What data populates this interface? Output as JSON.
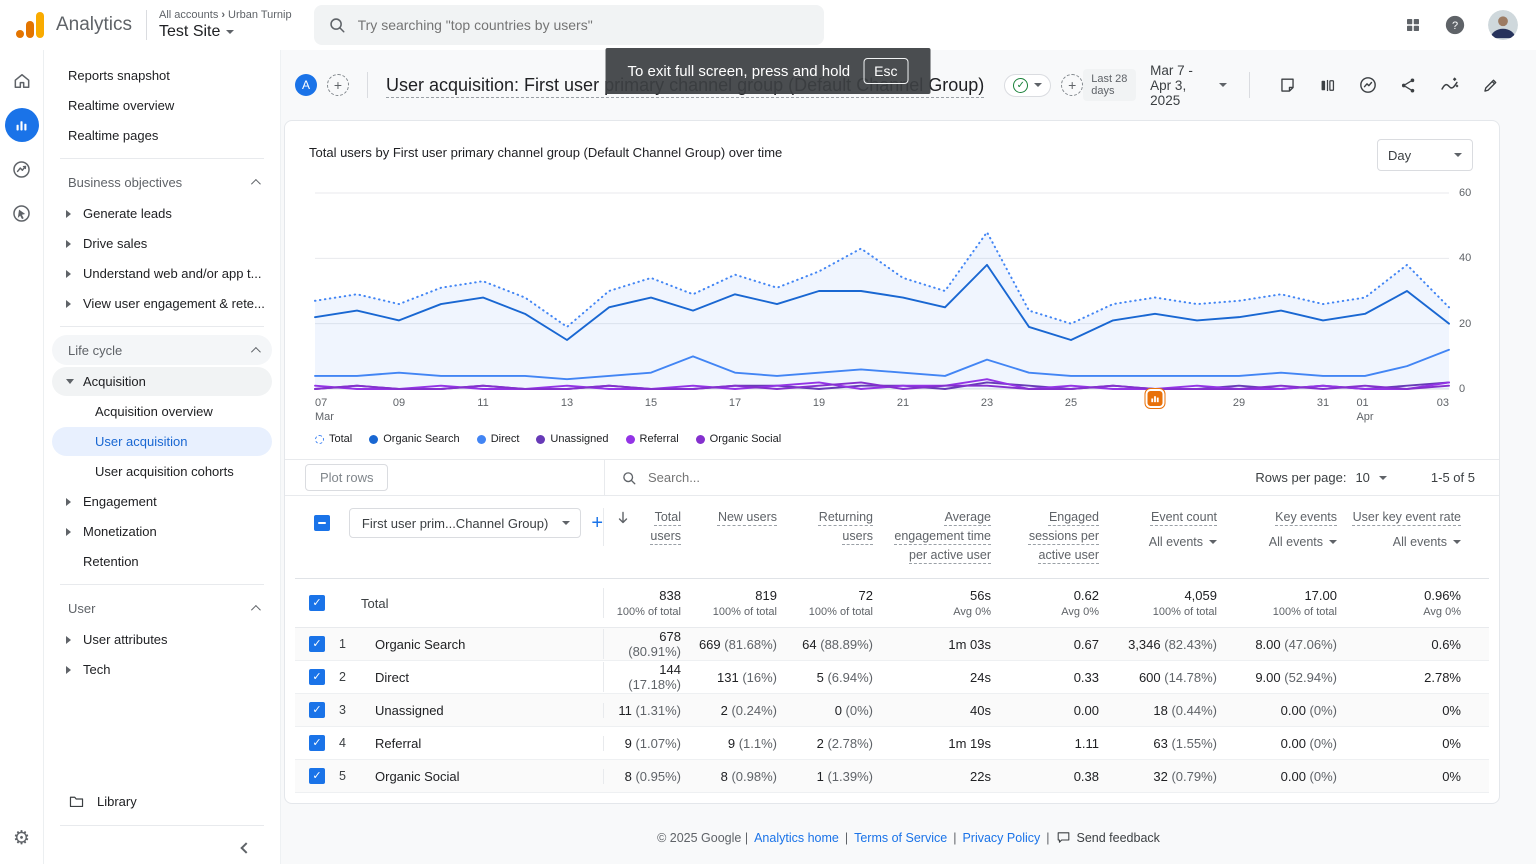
{
  "topbar": {
    "product_name": "Analytics",
    "breadcrumb_account": "All accounts",
    "breadcrumb_property": "Urban Turnip",
    "property_name": "Test Site",
    "search_placeholder": "Try searching \"top countries by users\""
  },
  "toast": {
    "message": "To exit full screen, press and hold",
    "key_label": "Esc"
  },
  "report_header": {
    "avatar_letter": "A",
    "title": "User acquisition: First user primary channel group (Default Channel Group)",
    "date_preset": "Last 28 days",
    "date_range": "Mar 7 - Apr 3, 2025"
  },
  "sidebar": {
    "sections": [
      {
        "items": [
          {
            "label": "Reports snapshot"
          },
          {
            "label": "Realtime overview"
          },
          {
            "label": "Realtime pages"
          }
        ]
      },
      {
        "header": "Business objectives",
        "items": [
          {
            "label": "Generate leads",
            "arrow": "right"
          },
          {
            "label": "Drive sales",
            "arrow": "right"
          },
          {
            "label": "Understand web and/or app t...",
            "arrow": "right"
          },
          {
            "label": "View user engagement & rete...",
            "arrow": "right"
          }
        ]
      },
      {
        "header": "Life cycle",
        "header_bg": true,
        "items": [
          {
            "label": "Acquisition",
            "arrow": "down",
            "pill": true
          },
          {
            "label": "Acquisition overview",
            "child": true
          },
          {
            "label": "User acquisition",
            "child": true,
            "active": true
          },
          {
            "label": "User acquisition cohorts",
            "child": true
          },
          {
            "label": "Engagement",
            "arrow": "right"
          },
          {
            "label": "Monetization",
            "arrow": "right"
          },
          {
            "label": "Retention",
            "indent": true
          }
        ]
      },
      {
        "header": "User",
        "items": [
          {
            "label": "User attributes",
            "arrow": "right"
          },
          {
            "label": "Tech",
            "arrow": "right"
          }
        ]
      }
    ],
    "library_label": "Library"
  },
  "chart": {
    "title": "Total users by First user primary channel group (Default Channel Group) over time",
    "granularity": "Day"
  },
  "chart_data": {
    "type": "line",
    "title": "Total users by First user primary channel group (Default Channel Group) over time",
    "ylim": [
      0,
      60
    ],
    "y_ticks": [
      0,
      20,
      40,
      60
    ],
    "grid": true,
    "legend_position": "bottom",
    "x": [
      "Mar 7",
      "Mar 8",
      "Mar 9",
      "Mar 10",
      "Mar 11",
      "Mar 12",
      "Mar 13",
      "Mar 14",
      "Mar 15",
      "Mar 16",
      "Mar 17",
      "Mar 18",
      "Mar 19",
      "Mar 20",
      "Mar 21",
      "Mar 22",
      "Mar 23",
      "Mar 24",
      "Mar 25",
      "Mar 26",
      "Mar 27",
      "Mar 28",
      "Mar 29",
      "Mar 30",
      "Mar 31",
      "Apr 1",
      "Apr 2",
      "Apr 3"
    ],
    "x_ticks": [
      {
        "idx": 0,
        "label": "07",
        "sub": "Mar"
      },
      {
        "idx": 2,
        "label": "09"
      },
      {
        "idx": 4,
        "label": "11"
      },
      {
        "idx": 6,
        "label": "13"
      },
      {
        "idx": 8,
        "label": "15"
      },
      {
        "idx": 10,
        "label": "17"
      },
      {
        "idx": 12,
        "label": "19"
      },
      {
        "idx": 14,
        "label": "21"
      },
      {
        "idx": 16,
        "label": "23"
      },
      {
        "idx": 18,
        "label": "25"
      },
      {
        "idx": 20,
        "label": "27"
      },
      {
        "idx": 22,
        "label": "29"
      },
      {
        "idx": 24,
        "label": "31"
      },
      {
        "idx": 25,
        "label": "01",
        "sub": "Apr"
      },
      {
        "idx": 27,
        "label": "03"
      }
    ],
    "anomaly_day_index": 20,
    "series": [
      {
        "name": "Total",
        "color": "#4285f4",
        "style": "dotted",
        "fill": true,
        "values": [
          27,
          29,
          26,
          31,
          33,
          28,
          19,
          30,
          34,
          29,
          35,
          31,
          36,
          43,
          34,
          30,
          48,
          24,
          20,
          26,
          28,
          26,
          27,
          29,
          26,
          28,
          38,
          25
        ]
      },
      {
        "name": "Organic Search",
        "color": "#1967d2",
        "style": "solid",
        "values": [
          22,
          24,
          21,
          26,
          28,
          23,
          15,
          25,
          28,
          24,
          29,
          26,
          30,
          30,
          28,
          25,
          38,
          19,
          15,
          21,
          23,
          21,
          22,
          24,
          21,
          23,
          30,
          20
        ]
      },
      {
        "name": "Direct",
        "color": "#4285f4",
        "style": "solid",
        "values": [
          4,
          4,
          5,
          4,
          4,
          4,
          3,
          4,
          5,
          10,
          5,
          4,
          5,
          6,
          5,
          4,
          9,
          5,
          4,
          4,
          4,
          4,
          4,
          5,
          4,
          4,
          7,
          12
        ]
      },
      {
        "name": "Unassigned",
        "color": "#673ab7",
        "style": "solid",
        "values": [
          0,
          1,
          0,
          0,
          1,
          0,
          0,
          1,
          0,
          0,
          1,
          1,
          0,
          1,
          1,
          0,
          2,
          1,
          0,
          1,
          0,
          0,
          1,
          0,
          1,
          0,
          1,
          2
        ]
      },
      {
        "name": "Referral",
        "color": "#9334e6",
        "style": "solid",
        "values": [
          1,
          0,
          0,
          1,
          0,
          0,
          1,
          0,
          0,
          1,
          0,
          1,
          2,
          0,
          1,
          1,
          3,
          0,
          1,
          0,
          0,
          1,
          0,
          0,
          1,
          0,
          0,
          2
        ]
      },
      {
        "name": "Organic Social",
        "color": "#8430ce",
        "style": "solid",
        "values": [
          0,
          1,
          0,
          0,
          1,
          0,
          0,
          1,
          0,
          0,
          1,
          0,
          1,
          2,
          0,
          1,
          1,
          0,
          0,
          1,
          0,
          0,
          0,
          1,
          0,
          1,
          0,
          1
        ]
      }
    ]
  },
  "table": {
    "plot_rows_label": "Plot rows",
    "search_placeholder": "Search...",
    "rows_per_page_label": "Rows per page:",
    "rows_per_page_value": "10",
    "pagination": "1-5 of 5",
    "dimension_dropdown": "First user prim...Channel Group)",
    "columns": [
      {
        "label": "Total users"
      },
      {
        "label": "New users"
      },
      {
        "label": "Returning users"
      },
      {
        "label": "Average engagement time per active user"
      },
      {
        "label": "Engaged sessions per active user"
      },
      {
        "label": "Event count",
        "sub": "All events"
      },
      {
        "label": "Key events",
        "sub": "All events"
      },
      {
        "label": "User key event rate",
        "sub": "All events"
      }
    ],
    "total_row": {
      "label": "Total",
      "cells": [
        {
          "main": "838",
          "sub": "100% of total"
        },
        {
          "main": "819",
          "sub": "100% of total"
        },
        {
          "main": "72",
          "sub": "100% of total"
        },
        {
          "main": "56s",
          "sub": "Avg 0%"
        },
        {
          "main": "0.62",
          "sub": "Avg 0%"
        },
        {
          "main": "4,059",
          "sub": "100% of total"
        },
        {
          "main": "17.00",
          "sub": "100% of total"
        },
        {
          "main": "0.96%",
          "sub": "Avg 0%"
        }
      ]
    },
    "rows": [
      {
        "index": "1",
        "channel": "Organic Search",
        "cells": [
          "678 (80.91%)",
          "669 (81.68%)",
          "64 (88.89%)",
          "1m 03s",
          "0.67",
          "3,346 (82.43%)",
          "8.00 (47.06%)",
          "0.6%"
        ]
      },
      {
        "index": "2",
        "channel": "Direct",
        "cells": [
          "144 (17.18%)",
          "131 (16%)",
          "5 (6.94%)",
          "24s",
          "0.33",
          "600 (14.78%)",
          "9.00 (52.94%)",
          "2.78%"
        ]
      },
      {
        "index": "3",
        "channel": "Unassigned",
        "cells": [
          "11 (1.31%)",
          "2 (0.24%)",
          "0 (0%)",
          "40s",
          "0.00",
          "18 (0.44%)",
          "0.00 (0%)",
          "0%"
        ]
      },
      {
        "index": "4",
        "channel": "Referral",
        "cells": [
          "9 (1.07%)",
          "9 (1.1%)",
          "2 (2.78%)",
          "1m 19s",
          "1.11",
          "63 (1.55%)",
          "0.00 (0%)",
          "0%"
        ]
      },
      {
        "index": "5",
        "channel": "Organic Social",
        "cells": [
          "8 (0.95%)",
          "8 (0.98%)",
          "1 (1.39%)",
          "22s",
          "0.38",
          "32 (0.79%)",
          "0.00 (0%)",
          "0%"
        ]
      }
    ]
  },
  "footer": {
    "copyright": "© 2025 Google |",
    "links": [
      "Analytics home",
      "Terms of Service",
      "Privacy Policy"
    ],
    "feedback_label": "Send feedback"
  },
  "colors": {
    "accent": "#1a73e8",
    "active_bg": "#e8f0fe",
    "anomaly": "#e8710a",
    "green_check": "#188038"
  }
}
